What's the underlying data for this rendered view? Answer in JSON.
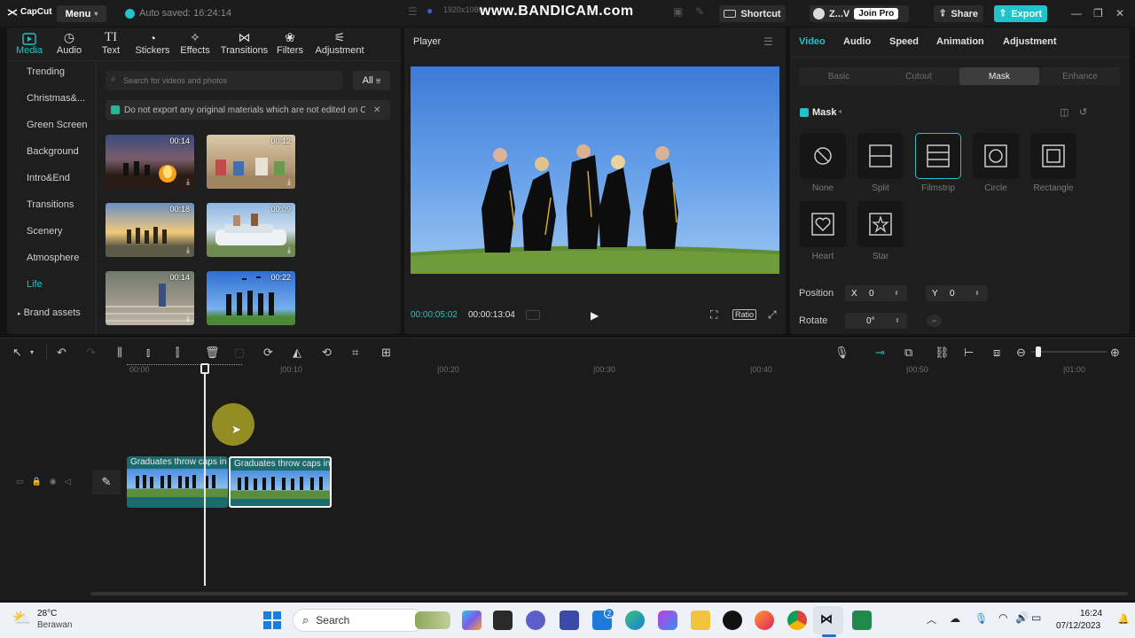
{
  "titlebar": {
    "app_name": "CapCut",
    "menu_label": "Menu",
    "autosave_text": "Auto saved: 16:24:14",
    "recording_watermark": "www.BANDICAM.com",
    "resolution_text": "1920x1080",
    "shortcut_label": "Shortcut",
    "user_label": "Z...V",
    "join_pro_label": "Join Pro",
    "share_label": "Share",
    "export_label": "Export"
  },
  "media_tabs": [
    {
      "label": "Media",
      "icon": "media-icon"
    },
    {
      "label": "Audio",
      "icon": "audio-icon"
    },
    {
      "label": "Text",
      "icon": "text-icon"
    },
    {
      "label": "Stickers",
      "icon": "stickers-icon"
    },
    {
      "label": "Effects",
      "icon": "effects-icon"
    },
    {
      "label": "Transitions",
      "icon": "transitions-icon"
    },
    {
      "label": "Filters",
      "icon": "filters-icon"
    },
    {
      "label": "Adjustment",
      "icon": "adjustment-icon"
    }
  ],
  "categories": [
    "Trending",
    "Christmas&...",
    "Green Screen",
    "Background",
    "Intro&End",
    "Transitions",
    "Scenery",
    "Atmosphere",
    "Life",
    "Brand assets"
  ],
  "active_category": "Life",
  "search": {
    "placeholder": "Search for videos and photos",
    "filter_label": "All"
  },
  "notice": "Do not export any original materials which are not edited on C",
  "media_items": [
    {
      "duration": "00:14",
      "scene": "campfire"
    },
    {
      "duration": "00:12",
      "scene": "classroom"
    },
    {
      "duration": "00:18",
      "scene": "sunset-group"
    },
    {
      "duration": "00:09",
      "scene": "car-roof"
    },
    {
      "duration": "00:14",
      "scene": "steps"
    },
    {
      "duration": "00:22",
      "scene": "graduates"
    }
  ],
  "player": {
    "title": "Player",
    "current_time": "00:00:05:02",
    "total_time": "00:00:13:04",
    "ratio_label": "Ratio"
  },
  "inspector": {
    "tabs": [
      "Video",
      "Audio",
      "Speed",
      "Animation",
      "Adjustment"
    ],
    "active_tab": "Video",
    "subtabs": [
      "Basic",
      "Cutout",
      "Mask",
      "Enhance"
    ],
    "active_subtab": "Mask",
    "mask_label": "Mask",
    "masks": [
      "None",
      "Split",
      "Filmstrip",
      "Circle",
      "Rectangle",
      "Heart",
      "Star"
    ],
    "active_mask": "Filmstrip",
    "position_label": "Position",
    "x_label": "X",
    "x_value": "0",
    "y_label": "Y",
    "y_value": "0",
    "rotate_label": "Rotate",
    "rotate_value": "0°"
  },
  "timeline": {
    "ruler_labels": [
      "00:00",
      "|00:10",
      "|00:20",
      "|00:30",
      "|00:40",
      "|00:50",
      "|01:00"
    ],
    "clips": [
      {
        "title": "Graduates throw caps in",
        "selected": false
      },
      {
        "title": "Graduates throw caps in",
        "selected": true
      }
    ]
  },
  "taskbar": {
    "temperature": "28°C",
    "weather": "Berawan",
    "search_label": "Search",
    "time": "16:24",
    "date": "07/12/2023",
    "mail_badge": "2"
  },
  "colors": {
    "accent": "#1fc3c9",
    "panel": "#1e1e1e",
    "background": "#131313",
    "clip": "#1b6b6c"
  }
}
